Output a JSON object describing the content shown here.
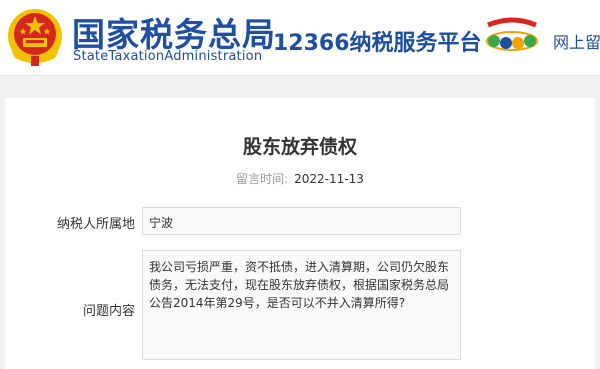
{
  "header": {
    "brand_cn": "国家税务总局",
    "brand_en": "StateTaxationAdministration",
    "platform": "12366纳税服务平台",
    "nav_link": "网上留"
  },
  "colors": {
    "brand_blue": "#1e4fa0",
    "emblem_red": "#d7261e",
    "emblem_gold": "#f2c200"
  },
  "icons": {
    "emblem": "national-emblem-icon",
    "platform_logo": "12366-logo-icon"
  },
  "message": {
    "title": "股东放弃债权",
    "date_label": "留言时间:",
    "date_value": "2022-11-13",
    "region_label": "纳税人所属地",
    "region_value": "宁波",
    "question_label": "问题内容",
    "question_text": "我公司亏损严重，资不抵债，进入清算期，公司仍欠股东债务，无法支付，现在股东放弃债权，根据国家税务总局公告2014年第29号，是否可以不并入清算所得?"
  }
}
